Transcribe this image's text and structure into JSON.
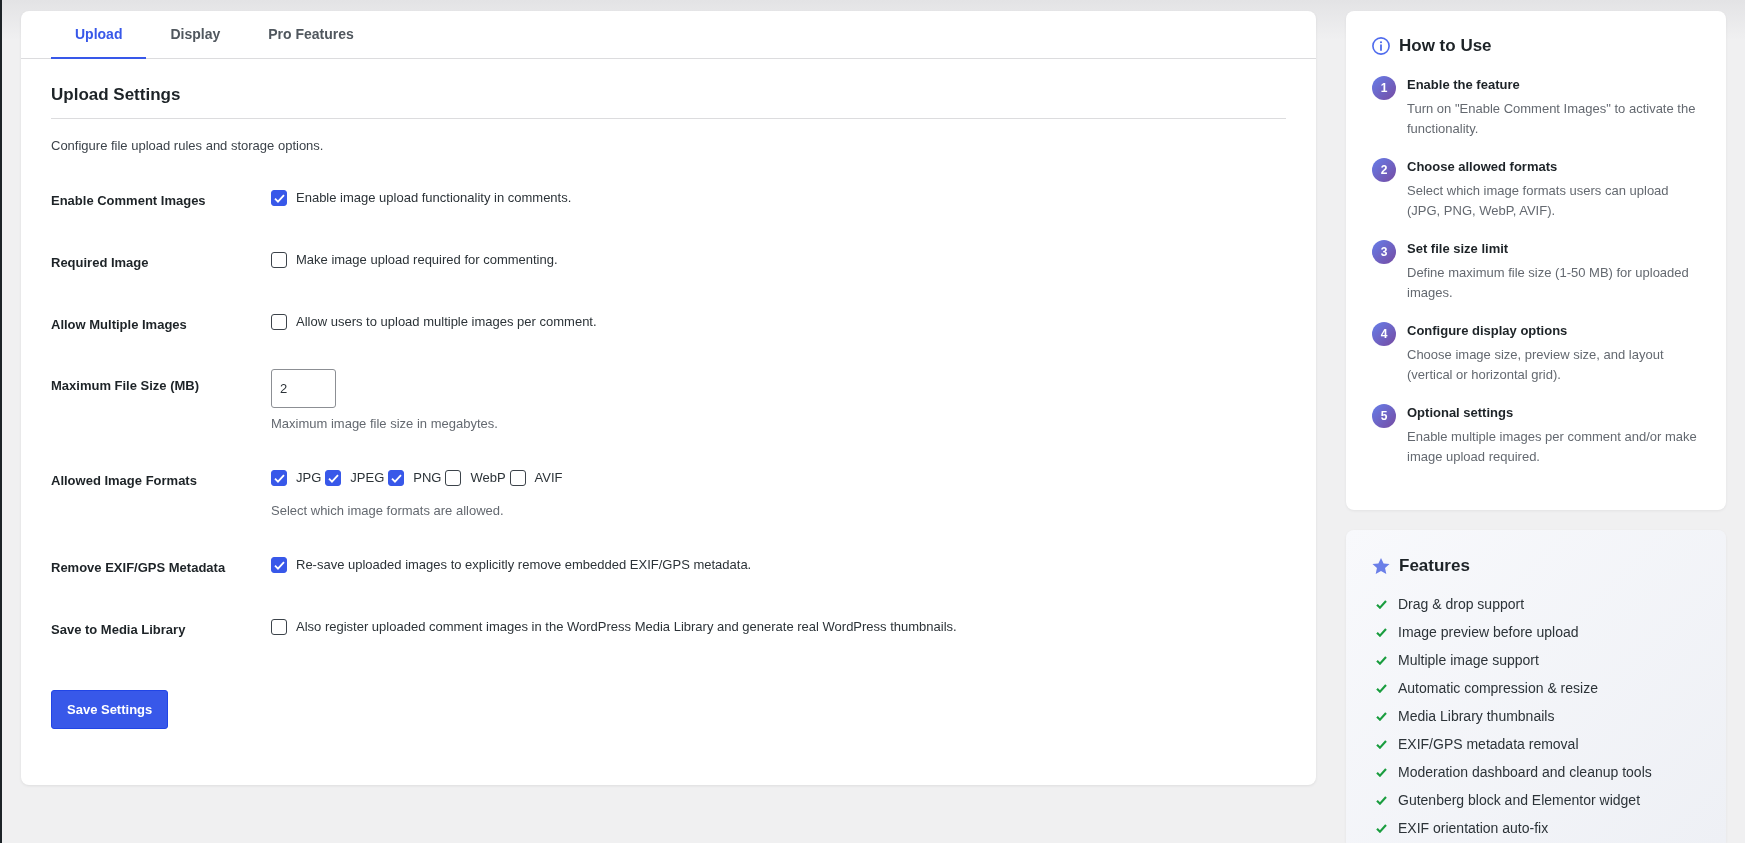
{
  "tabs": [
    {
      "label": "Upload",
      "selected": true
    },
    {
      "label": "Display",
      "selected": false
    },
    {
      "label": "Pro Features",
      "selected": false
    }
  ],
  "section": {
    "title": "Upload Settings",
    "description": "Configure file upload rules and storage options."
  },
  "settings": [
    {
      "kind": "checkbox",
      "label": "Enable Comment Images",
      "checked": true,
      "text": "Enable image upload functionality in comments."
    },
    {
      "kind": "checkbox",
      "label": "Required Image",
      "checked": false,
      "text": "Make image upload required for commenting."
    },
    {
      "kind": "checkbox",
      "label": "Allow Multiple Images",
      "checked": false,
      "text": "Allow users to upload multiple images per comment."
    },
    {
      "kind": "number",
      "label": "Maximum File Size (MB)",
      "value": "2",
      "help": "Maximum image file size in megabytes."
    },
    {
      "kind": "checkbox_group",
      "label": "Allowed Image Formats",
      "options": [
        {
          "label": "JPG",
          "checked": true
        },
        {
          "label": "JPEG",
          "checked": true
        },
        {
          "label": "PNG",
          "checked": true
        },
        {
          "label": "WebP",
          "checked": false
        },
        {
          "label": "AVIF",
          "checked": false
        }
      ],
      "help": "Select which image formats are allowed."
    },
    {
      "kind": "checkbox",
      "label": "Remove EXIF/GPS Metadata",
      "checked": true,
      "text": "Re-save uploaded images to explicitly remove embedded EXIF/GPS metadata."
    },
    {
      "kind": "checkbox",
      "label": "Save to Media Library",
      "checked": false,
      "text": "Also register uploaded comment images in the WordPress Media Library and generate real WordPress thumbnails."
    }
  ],
  "save_button": "Save Settings",
  "how_to_use": {
    "title": "How to Use",
    "steps": [
      {
        "number": "1",
        "title": "Enable the feature",
        "text": "Turn on \"Enable Comment Images\" to activate the functionality."
      },
      {
        "number": "2",
        "title": "Choose allowed formats",
        "text": "Select which image formats users can upload (JPG, PNG, WebP, AVIF)."
      },
      {
        "number": "3",
        "title": "Set file size limit",
        "text": "Define maximum file size (1-50 MB) for uploaded images."
      },
      {
        "number": "4",
        "title": "Configure display options",
        "text": "Choose image size, preview size, and layout (vertical or horizontal grid)."
      },
      {
        "number": "5",
        "title": "Optional settings",
        "text": "Enable multiple images per comment and/or make image upload required."
      }
    ]
  },
  "features": {
    "title": "Features",
    "items": [
      "Drag & drop support",
      "Image preview before upload",
      "Multiple image support",
      "Automatic compression & resize",
      "Media Library thumbnails",
      "EXIF/GPS metadata removal",
      "Moderation dashboard and cleanup tools",
      "Gutenberg block and Elementor widget",
      "EXIF orientation auto-fix"
    ]
  }
}
